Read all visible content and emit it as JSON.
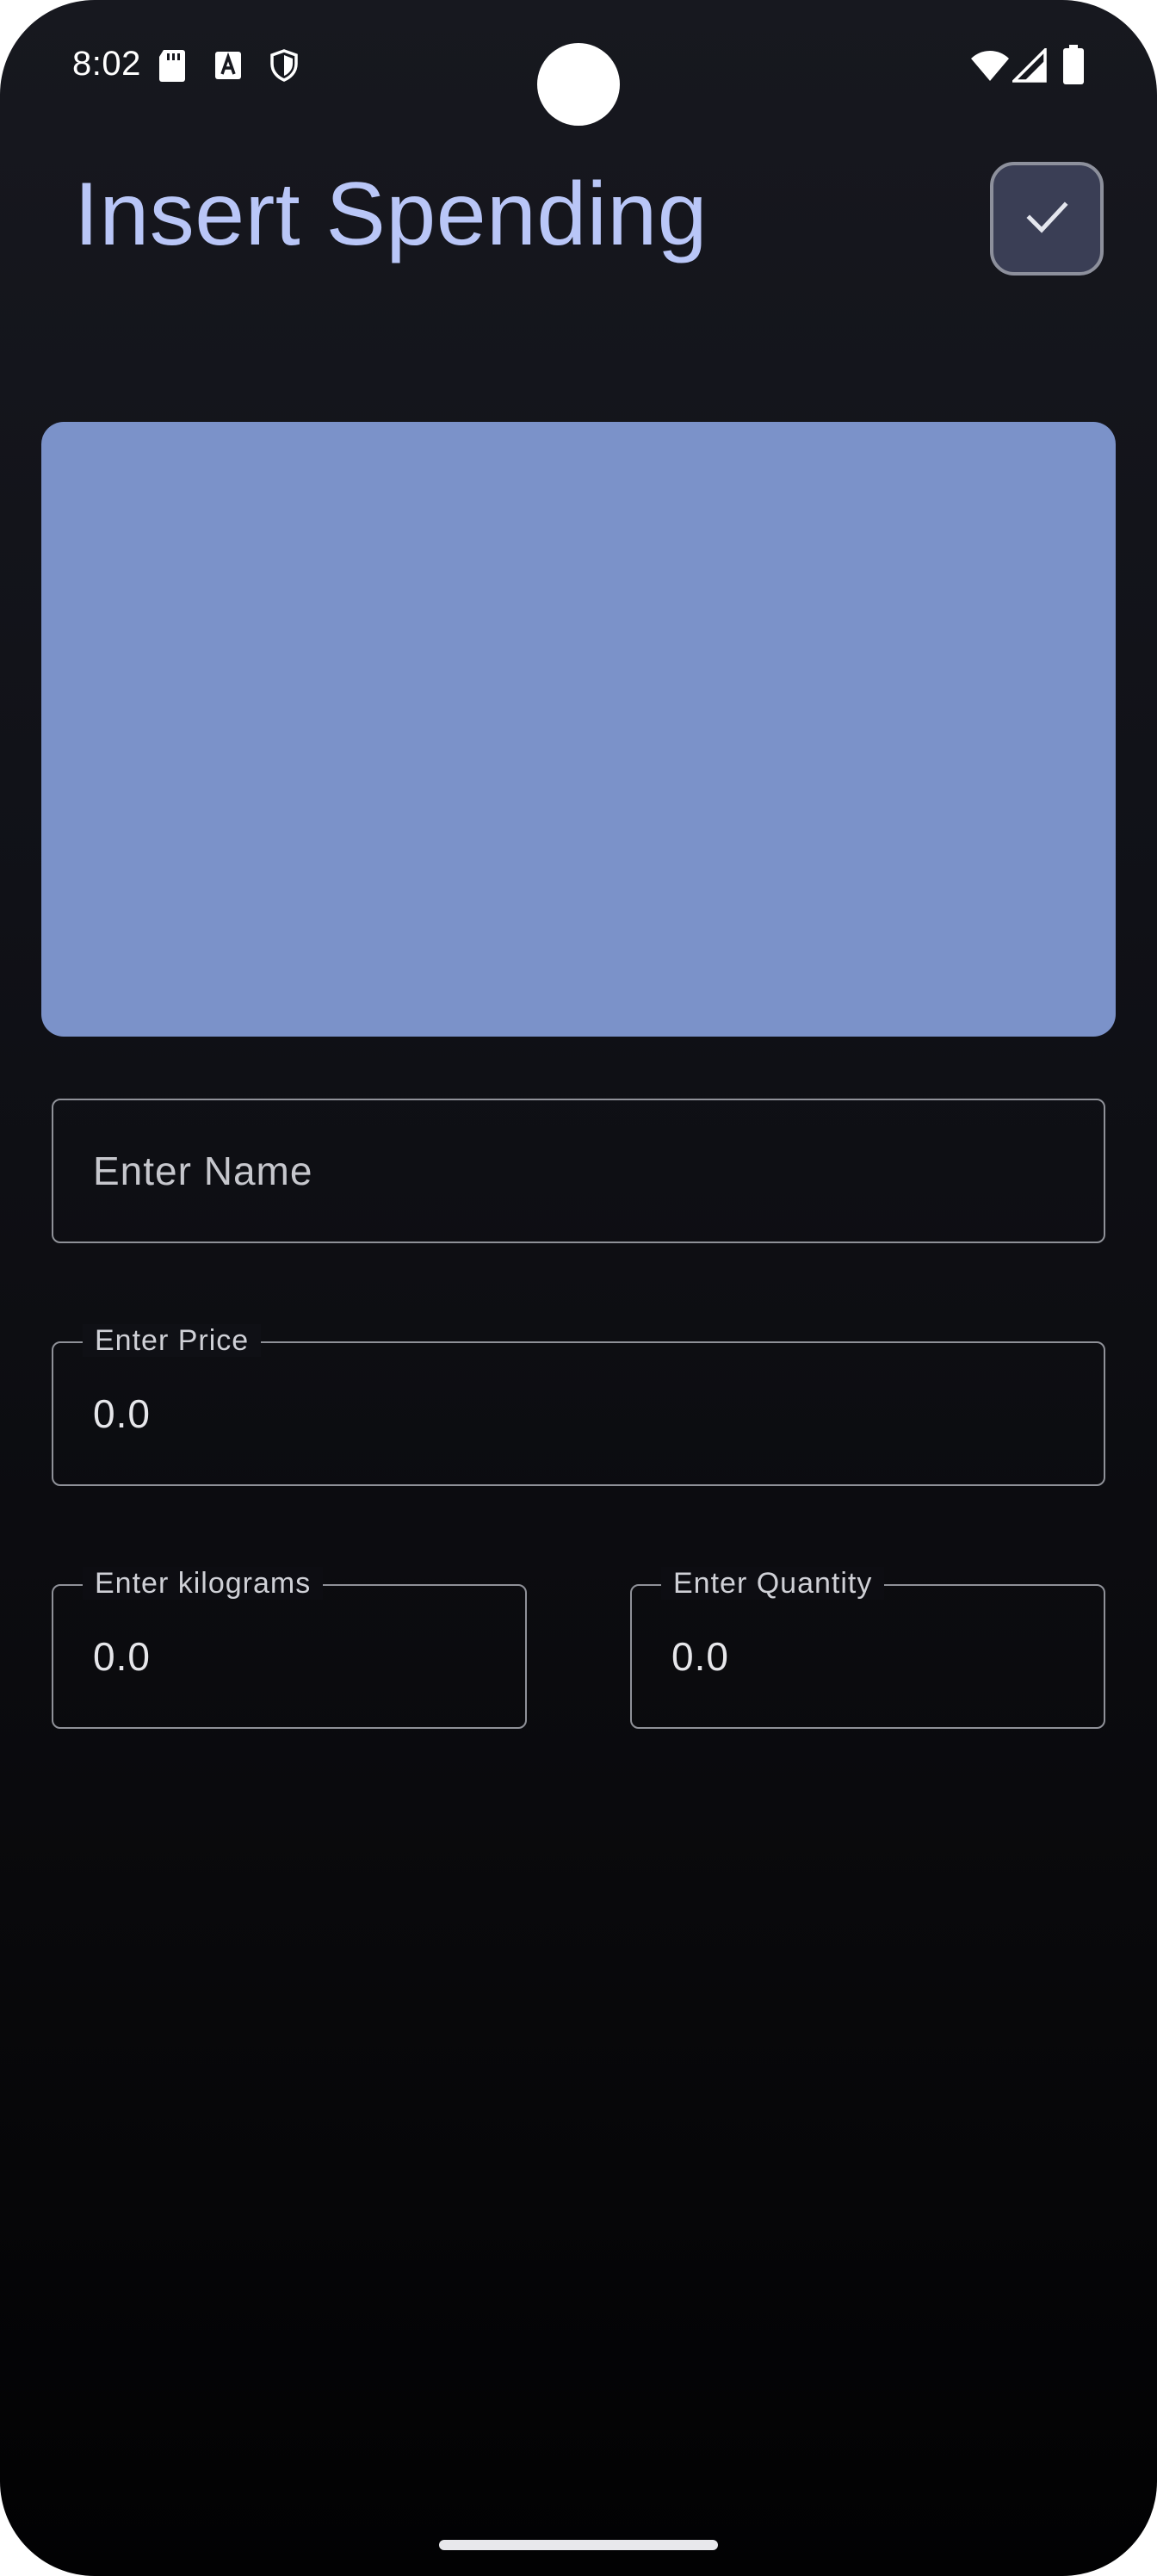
{
  "status_bar": {
    "time": "8:02",
    "icons": [
      "sd-card-icon",
      "text-a-icon",
      "shield-icon",
      "wifi-icon",
      "cell-signal-icon",
      "battery-icon"
    ]
  },
  "header": {
    "title": "Insert Spending",
    "confirm_icon": "check-icon"
  },
  "image_area": {
    "color": "#7b92c9"
  },
  "form": {
    "name": {
      "placeholder": "Enter Name",
      "value": ""
    },
    "price": {
      "label": "Enter Price",
      "value": "0.0"
    },
    "kilograms": {
      "label": "Enter kilograms",
      "value": "0.0"
    },
    "quantity": {
      "label": "Enter Quantity",
      "value": "0.0"
    }
  },
  "colors": {
    "title": "#b9c6f7",
    "accent_button": "#3a3e55",
    "field_border": "#8f9198"
  }
}
